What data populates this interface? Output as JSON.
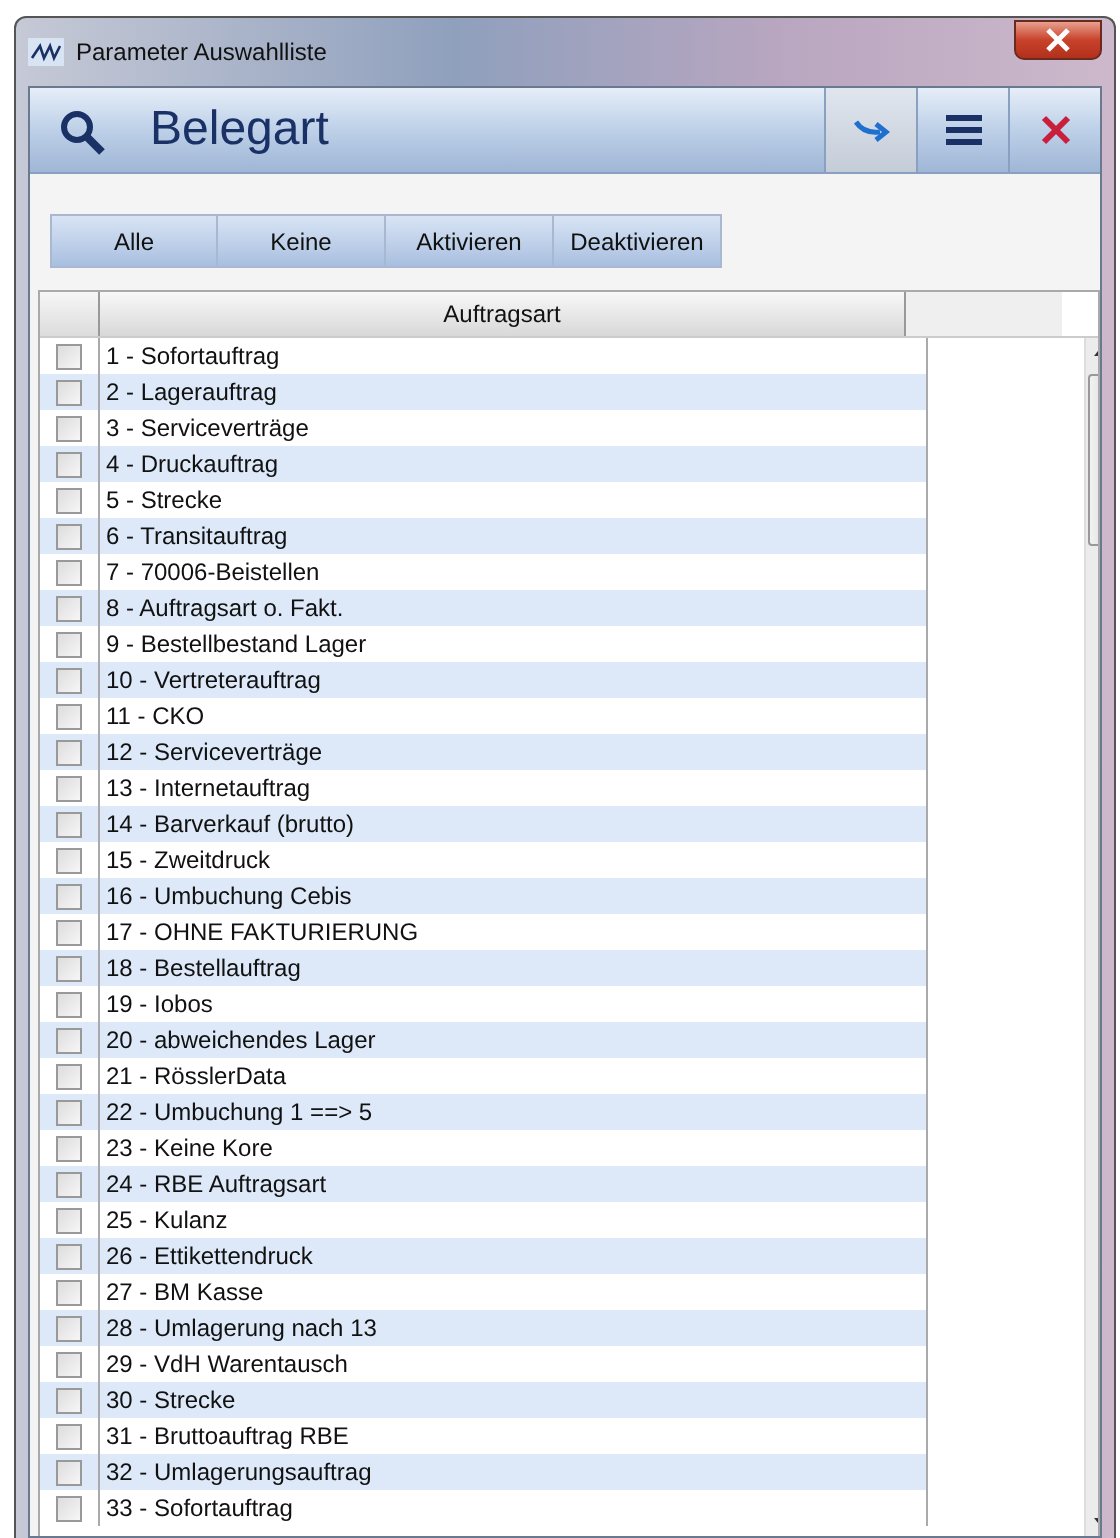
{
  "window": {
    "title": "Parameter Auswahlliste"
  },
  "header": {
    "title": "Belegart"
  },
  "buttons": [
    "Alle",
    "Keine",
    "Aktivieren",
    "Deaktivieren"
  ],
  "table": {
    "columns": [
      "Auftragsart"
    ],
    "rows": [
      {
        "label": "1 - Sofortauftrag",
        "checked": false
      },
      {
        "label": "2 - Lagerauftrag",
        "checked": false
      },
      {
        "label": "3 - Serviceverträge",
        "checked": false
      },
      {
        "label": "4 - Druckauftrag",
        "checked": false
      },
      {
        "label": "5 - Strecke",
        "checked": false
      },
      {
        "label": "6 - Transitauftrag",
        "checked": false
      },
      {
        "label": "7 - 70006-Beistellen",
        "checked": false
      },
      {
        "label": "8 - Auftragsart o. Fakt.",
        "checked": false
      },
      {
        "label": "9 - Bestellbestand Lager",
        "checked": false
      },
      {
        "label": "10 - Vertreterauftrag",
        "checked": false
      },
      {
        "label": "11 - CKO",
        "checked": false
      },
      {
        "label": "12 - Serviceverträge",
        "checked": false
      },
      {
        "label": "13 - Internetauftrag",
        "checked": false
      },
      {
        "label": "14 - Barverkauf (brutto)",
        "checked": false
      },
      {
        "label": "15 - Zweitdruck",
        "checked": false
      },
      {
        "label": "16 - Umbuchung Cebis",
        "checked": false
      },
      {
        "label": "17 - OHNE FAKTURIERUNG",
        "checked": false
      },
      {
        "label": "18 - Bestellauftrag",
        "checked": false
      },
      {
        "label": "19 - Iobos",
        "checked": false
      },
      {
        "label": "20 - abweichendes Lager",
        "checked": false
      },
      {
        "label": "21 - RösslerData",
        "checked": false
      },
      {
        "label": "22 - Umbuchung 1 ==> 5",
        "checked": false
      },
      {
        "label": "23 - Keine Kore",
        "checked": false
      },
      {
        "label": "24 - RBE Auftragsart",
        "checked": false
      },
      {
        "label": "25 - Kulanz",
        "checked": false
      },
      {
        "label": "26 - Ettikettendruck",
        "checked": false
      },
      {
        "label": "27 - BM Kasse",
        "checked": false
      },
      {
        "label": "28 - Umlagerung nach 13",
        "checked": false
      },
      {
        "label": "29 - VdH Warentausch",
        "checked": false
      },
      {
        "label": "30 - Strecke",
        "checked": false
      },
      {
        "label": "31 - Bruttoauftrag RBE",
        "checked": false
      },
      {
        "label": "32 - Umlagerungsauftrag",
        "checked": false
      },
      {
        "label": "33 - Sofortauftrag",
        "checked": false
      }
    ]
  }
}
